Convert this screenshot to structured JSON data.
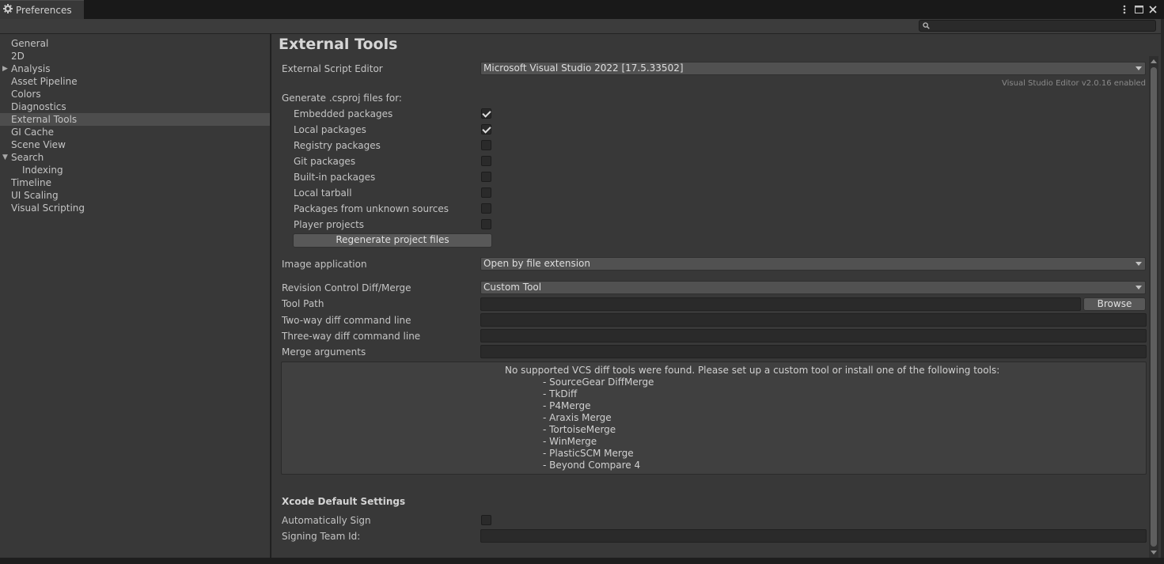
{
  "window": {
    "tab_title": "Preferences",
    "icons": [
      "gear-icon",
      "kebab-menu-icon",
      "maximize-icon",
      "close-icon"
    ]
  },
  "search": {
    "placeholder": "",
    "icon": "search-icon"
  },
  "sidebar": {
    "items": [
      {
        "label": "General"
      },
      {
        "label": "2D"
      },
      {
        "label": "Analysis",
        "expander": "collapsed"
      },
      {
        "label": "Asset Pipeline"
      },
      {
        "label": "Colors"
      },
      {
        "label": "Diagnostics"
      },
      {
        "label": "External Tools",
        "selected": true
      },
      {
        "label": "GI Cache"
      },
      {
        "label": "Scene View"
      },
      {
        "label": "Search",
        "expander": "expanded"
      },
      {
        "label": "Indexing",
        "child": true
      },
      {
        "label": "Timeline"
      },
      {
        "label": "UI Scaling"
      },
      {
        "label": "Visual Scripting"
      }
    ]
  },
  "main": {
    "title": "External Tools",
    "script_editor": {
      "label": "External Script Editor",
      "value": "Microsoft Visual Studio 2022 [17.5.33502]",
      "info": "Visual Studio Editor v2.0.16 enabled"
    },
    "csproj": {
      "label": "Generate .csproj files for:",
      "options": [
        {
          "label": "Embedded packages",
          "checked": true
        },
        {
          "label": "Local packages",
          "checked": true
        },
        {
          "label": "Registry packages",
          "checked": false
        },
        {
          "label": "Git packages",
          "checked": false
        },
        {
          "label": "Built-in packages",
          "checked": false
        },
        {
          "label": "Local tarball",
          "checked": false
        },
        {
          "label": "Packages from unknown sources",
          "checked": false
        },
        {
          "label": "Player projects",
          "checked": false
        }
      ],
      "regenerate_label": "Regenerate project files"
    },
    "image_app": {
      "label": "Image application",
      "value": "Open by file extension"
    },
    "revision_control": {
      "label": "Revision Control Diff/Merge",
      "value": "Custom Tool"
    },
    "tool_path": {
      "label": "Tool Path",
      "value": "",
      "browse_label": "Browse"
    },
    "two_way": {
      "label": "Two-way diff command line",
      "value": ""
    },
    "three_way": {
      "label": "Three-way diff command line",
      "value": ""
    },
    "merge_args": {
      "label": "Merge arguments",
      "value": ""
    },
    "vcs_help": {
      "message": "No supported VCS diff tools were found. Please set up a custom tool or install one of the following tools:",
      "tools": [
        "- SourceGear DiffMerge",
        "- TkDiff",
        "- P4Merge",
        "- Araxis Merge",
        "- TortoiseMerge",
        "- WinMerge",
        "- PlasticSCM Merge",
        "- Beyond Compare 4"
      ]
    },
    "xcode": {
      "heading": "Xcode Default Settings",
      "auto_sign_label": "Automatically Sign",
      "auto_sign_checked": false,
      "signing_team_label": "Signing Team Id:",
      "signing_team_value": ""
    }
  }
}
